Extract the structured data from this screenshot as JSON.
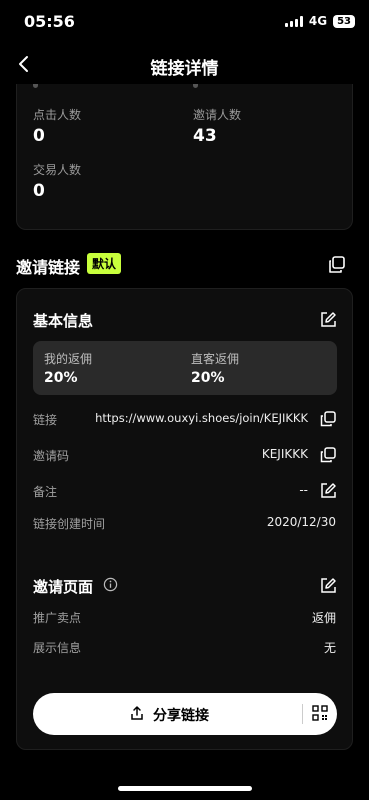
{
  "status_bar": {
    "time": "05:56",
    "network": "4G",
    "battery": "53"
  },
  "nav": {
    "title": "链接详情"
  },
  "stats": {
    "click_label": "点击人数",
    "click_value": "0",
    "invite_label": "邀请人数",
    "invite_value": "43",
    "trade_label": "交易人数",
    "trade_value": "0"
  },
  "invite_link": {
    "title": "邀请链接",
    "badge": "默认"
  },
  "basic_info": {
    "title": "基本信息",
    "my_rebate_label": "我的返佣",
    "my_rebate_value": "20%",
    "direct_rebate_label": "直客返佣",
    "direct_rebate_value": "20%",
    "link_label": "链接",
    "link_value": "https://www.ouxyi.shoes/join/KEJIKKK",
    "code_label": "邀请码",
    "code_value": "KEJIKKK",
    "note_label": "备注",
    "note_value": "--",
    "created_label": "链接创建时间",
    "created_value": "2020/12/30"
  },
  "invite_page": {
    "title": "邀请页面",
    "promo_label": "推广卖点",
    "promo_value": "返佣",
    "display_label": "展示信息",
    "display_value": "无"
  },
  "share": {
    "label": "分享链接"
  }
}
